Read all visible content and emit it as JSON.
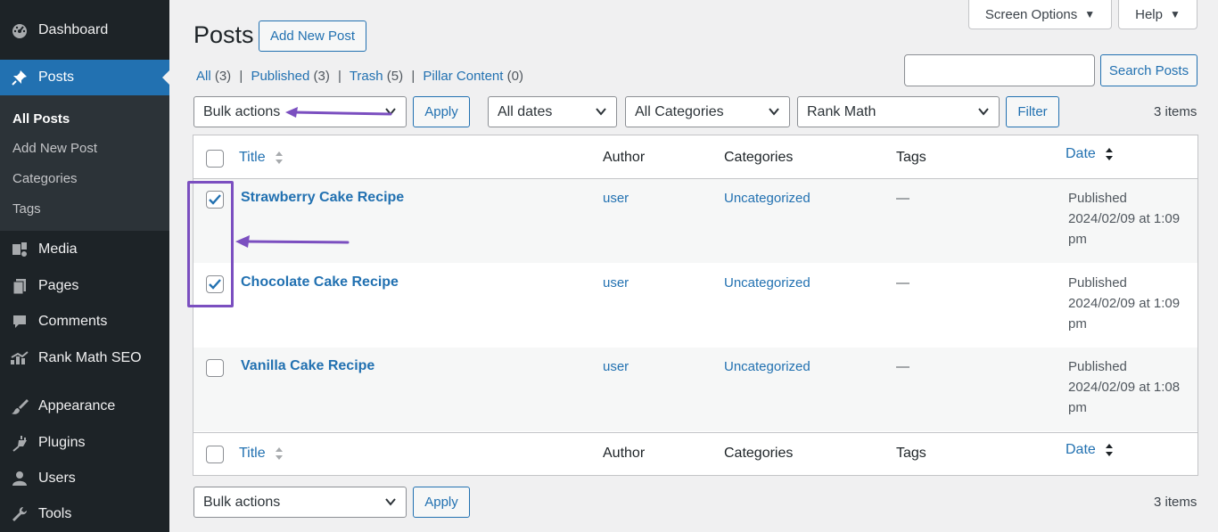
{
  "sidebar": {
    "items": [
      {
        "label": "Dashboard",
        "icon": "dashboard-icon"
      },
      {
        "label": "Posts",
        "icon": "pushpin-icon"
      },
      {
        "label": "Media",
        "icon": "media-icon"
      },
      {
        "label": "Pages",
        "icon": "pages-icon"
      },
      {
        "label": "Comments",
        "icon": "comments-icon"
      },
      {
        "label": "Rank Math SEO",
        "icon": "rank-math-icon"
      },
      {
        "label": "Appearance",
        "icon": "paintbrush-icon"
      },
      {
        "label": "Plugins",
        "icon": "plugin-icon"
      },
      {
        "label": "Users",
        "icon": "users-icon"
      },
      {
        "label": "Tools",
        "icon": "wrench-icon"
      }
    ],
    "submenu": [
      "All Posts",
      "Add New Post",
      "Categories",
      "Tags"
    ]
  },
  "top_buttons": {
    "screen_options": "Screen Options",
    "help": "Help"
  },
  "header": {
    "title": "Posts",
    "add_new": "Add New Post"
  },
  "views": [
    {
      "label": "All",
      "count": "(3)"
    },
    {
      "label": "Published",
      "count": "(3)"
    },
    {
      "label": "Trash",
      "count": "(5)"
    },
    {
      "label": "Pillar Content",
      "count": "(0)"
    }
  ],
  "views_separator": "|",
  "search": {
    "button": "Search Posts",
    "placeholder": ""
  },
  "filters": {
    "bulk_actions": "Bulk actions",
    "apply": "Apply",
    "dates": "All dates",
    "categories": "All Categories",
    "rank_math": "Rank Math",
    "filter": "Filter",
    "items_count": "3 items"
  },
  "columns": {
    "title": "Title",
    "author": "Author",
    "categories": "Categories",
    "tags": "Tags",
    "date": "Date"
  },
  "rows": [
    {
      "title": "Strawberry Cake Recipe",
      "author": "user",
      "category": "Uncategorized",
      "tags": "—",
      "status": "Published",
      "date1": "2024/02/09 at 1:09",
      "date2": "pm",
      "checked": true
    },
    {
      "title": "Chocolate Cake Recipe",
      "author": "user",
      "category": "Uncategorized",
      "tags": "—",
      "status": "Published",
      "date1": "2024/02/09 at 1:09",
      "date2": "pm",
      "checked": true
    },
    {
      "title": "Vanilla Cake Recipe",
      "author": "user",
      "category": "Uncategorized",
      "tags": "—",
      "status": "Published",
      "date1": "2024/02/09 at 1:08",
      "date2": "pm",
      "checked": false
    }
  ],
  "colors": {
    "accent": "#2271b1",
    "annotation": "#7b4fc0",
    "sidebar_bg": "#1d2327"
  }
}
